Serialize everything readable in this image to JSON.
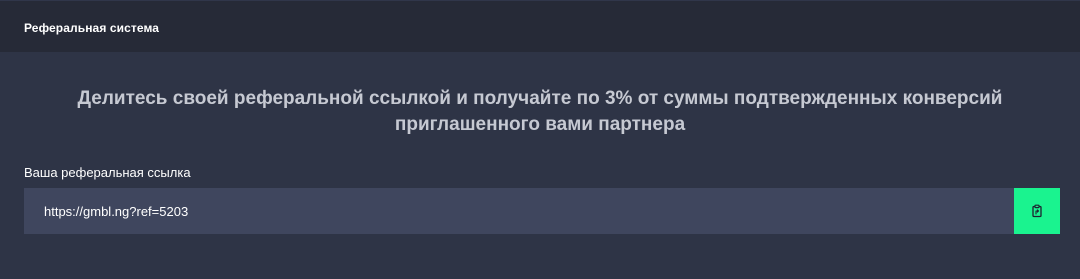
{
  "panel": {
    "title": "Реферальная система"
  },
  "headline": {
    "line1": "Делитесь своей реферальной ссылкой и получайте по 3% от суммы подтвержденных конверсий",
    "line2": "приглашенного вами партнера"
  },
  "referral": {
    "label": "Ваша реферальная ссылка",
    "link": "https://gmbl.ng?ref=5203",
    "copy_icon": "clipboard-copy-icon"
  },
  "colors": {
    "background": "#2e3446",
    "header": "#262a37",
    "input": "#3f465e",
    "accent": "#1af38f"
  }
}
